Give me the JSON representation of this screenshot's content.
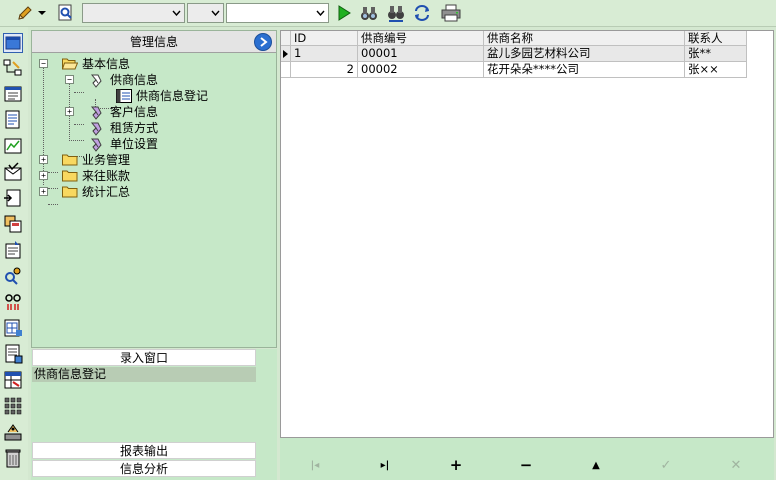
{
  "tree_panel": {
    "title": "管理信息",
    "nodes": {
      "basic": "基本信息",
      "supplier": "供商信息",
      "supplier_reg": "供商信息登记",
      "customer": "客户信息",
      "lease": "租赁方式",
      "unit": "单位设置",
      "business": "业务管理",
      "accounts": "来往账款",
      "stats": "统计汇总"
    }
  },
  "lower_panel": {
    "entry_window": "录入窗口",
    "selected_item": "供商信息登记",
    "report_output": "报表输出",
    "info_analysis": "信息分析"
  },
  "grid": {
    "columns": [
      "ID",
      "供商编号",
      "供商名称",
      "联系人"
    ],
    "rows": [
      {
        "id": "1",
        "code": "00001",
        "name": "盆儿多园艺材料公司",
        "contact": "张**"
      },
      {
        "id": "2",
        "code": "00002",
        "name": "花开朵朵****公司",
        "contact": "张××"
      }
    ]
  },
  "navigator": {
    "first": "|◂",
    "last": "▸|",
    "add": "+",
    "delete": "−",
    "up": "▲",
    "post": "✓",
    "cancel": "✕"
  }
}
